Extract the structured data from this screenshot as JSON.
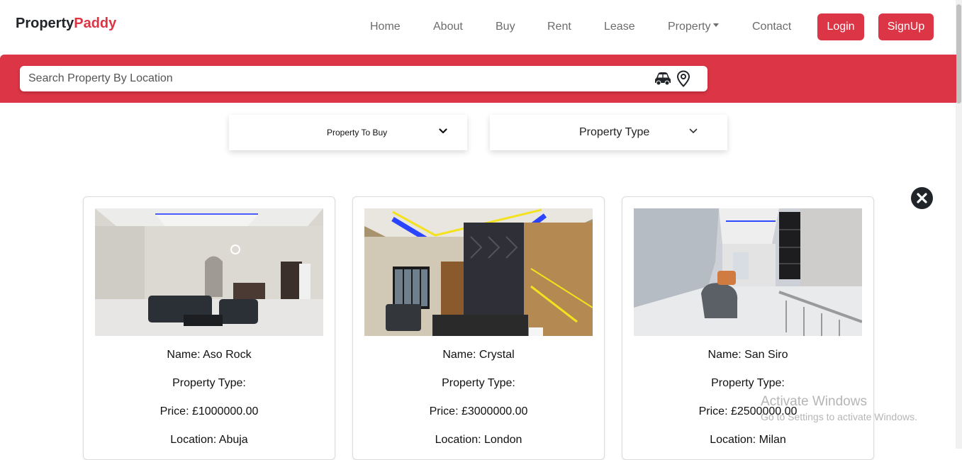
{
  "brand": {
    "part1": "Property",
    "part2": "Paddy"
  },
  "nav": {
    "home": "Home",
    "about": "About",
    "buy": "Buy",
    "rent": "Rent",
    "lease": "Lease",
    "property": "Property",
    "contact": "Contact",
    "login": "Login",
    "signup": "SignUp"
  },
  "search": {
    "placeholder": "Search Property By Location",
    "value": ""
  },
  "filters": {
    "purpose": "Property To Buy",
    "type": "Property Type"
  },
  "cards": [
    {
      "name": "Name: Aso Rock",
      "type": "Property Type:",
      "price": "Price: £1000000.00",
      "location": "Location: Abuja"
    },
    {
      "name": "Name: Crystal",
      "type": "Property Type:",
      "price": "Price: £3000000.00",
      "location": "Location: London"
    },
    {
      "name": "Name: San Siro",
      "type": "Property Type:",
      "price": "Price: £2500000.00",
      "location": "Location: Milan"
    }
  ],
  "watermark": {
    "title": "Activate Windows",
    "subtitle": "Go to Settings to activate Windows."
  },
  "colors": {
    "accent": "#dc3545",
    "text": "#212529",
    "nav_text": "#6c6c6c"
  },
  "icons": [
    "car-icon",
    "map-pin-icon",
    "chevron-down-icon",
    "close-icon"
  ]
}
